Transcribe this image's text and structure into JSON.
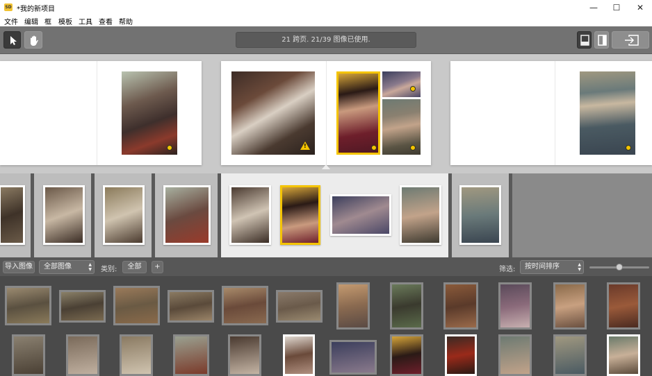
{
  "window": {
    "title": "*我的新项目",
    "app_icon": "SD",
    "minimize_glyph": "—",
    "maximize_glyph": "☐",
    "close_glyph": "✕"
  },
  "menu": [
    "文件",
    "编辑",
    "框",
    "模板",
    "工具",
    "查看",
    "帮助"
  ],
  "toolbar": {
    "status": "21 跨页. 21/39 图像已使用.",
    "select_tool_icon": "arrow-cursor-icon",
    "hand_tool_icon": "hand-icon",
    "view_single_icon": "single-page-view-icon",
    "view_spread_icon": "spread-view-icon",
    "export_icon": "export-icon"
  },
  "library_bar": {
    "import_label": "导入图像",
    "filter_select": "全部图像",
    "category_label": "类别:",
    "category_value": "全部",
    "add_label": "+",
    "sort_label": "筛选:",
    "sort_select": "按时间排序"
  },
  "colors": {
    "accent_yellow": "#f4c400",
    "toolbar_bg": "#727272",
    "spread_area_bg": "#c9c9c9",
    "strip_bg": "#8a8a8a",
    "library_bg": "#4a4a4a"
  }
}
